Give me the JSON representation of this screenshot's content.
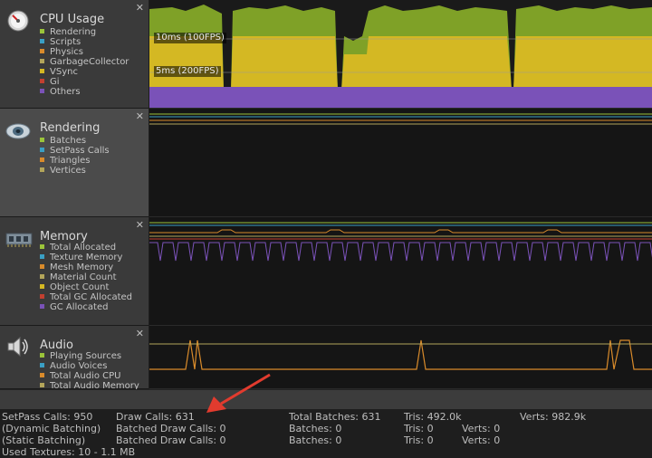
{
  "modules": [
    {
      "id": "cpu",
      "title": "CPU Usage",
      "icon": "cpu-usage-icon",
      "items": [
        {
          "label": "Rendering",
          "color": "#9bc43a"
        },
        {
          "label": "Scripts",
          "color": "#3a9fc4"
        },
        {
          "label": "Physics",
          "color": "#d98b2b"
        },
        {
          "label": "GarbageCollector",
          "color": "#b3a55a"
        },
        {
          "label": "VSync",
          "color": "#d4b823"
        },
        {
          "label": "Gi",
          "color": "#c24030"
        },
        {
          "label": "Others",
          "color": "#7a52b8"
        }
      ],
      "labels": {
        "fps100": "10ms (100FPS)",
        "fps200": "5ms (200FPS)"
      }
    },
    {
      "id": "rendering",
      "title": "Rendering",
      "icon": "rendering-icon",
      "items": [
        {
          "label": "Batches",
          "color": "#9bc43a"
        },
        {
          "label": "SetPass Calls",
          "color": "#3a9fc4"
        },
        {
          "label": "Triangles",
          "color": "#d98b2b"
        },
        {
          "label": "Vertices",
          "color": "#b3a55a"
        }
      ]
    },
    {
      "id": "memory",
      "title": "Memory",
      "icon": "memory-icon",
      "items": [
        {
          "label": "Total Allocated",
          "color": "#9bc43a"
        },
        {
          "label": "Texture Memory",
          "color": "#3a9fc4"
        },
        {
          "label": "Mesh Memory",
          "color": "#d98b2b"
        },
        {
          "label": "Material Count",
          "color": "#b3a55a"
        },
        {
          "label": "Object Count",
          "color": "#d4b823"
        },
        {
          "label": "Total GC Allocated",
          "color": "#c24030"
        },
        {
          "label": "GC Allocated",
          "color": "#7a52b8"
        }
      ]
    },
    {
      "id": "audio",
      "title": "Audio",
      "icon": "audio-icon",
      "items": [
        {
          "label": "Playing Sources",
          "color": "#9bc43a"
        },
        {
          "label": "Audio Voices",
          "color": "#3a9fc4"
        },
        {
          "label": "Total Audio CPU",
          "color": "#d98b2b"
        },
        {
          "label": "Total Audio Memory",
          "color": "#b3a55a"
        }
      ]
    }
  ],
  "stats": {
    "setpass": "SetPass Calls: 950",
    "dynamic": "(Dynamic Batching)",
    "static": "(Static Batching)",
    "used_textures": "Used Textures: 10 - 1.1 MB",
    "draw_calls": "Draw Calls: 631",
    "batched_dc_1": "Batched Draw Calls: 0",
    "batched_dc_2": "Batched Draw Calls: 0",
    "total_batches": "Total Batches: 631",
    "batches_1": "Batches: 0",
    "batches_2": "Batches: 0",
    "tris": "Tris: 492.0k",
    "tris_1": "Tris: 0",
    "tris_2": "Tris: 0",
    "verts": "Verts: 982.9k",
    "verts_1": "Verts: 0",
    "verts_2": "Verts: 0"
  },
  "colors": {
    "annotation_arrow": "#e23b2e"
  }
}
